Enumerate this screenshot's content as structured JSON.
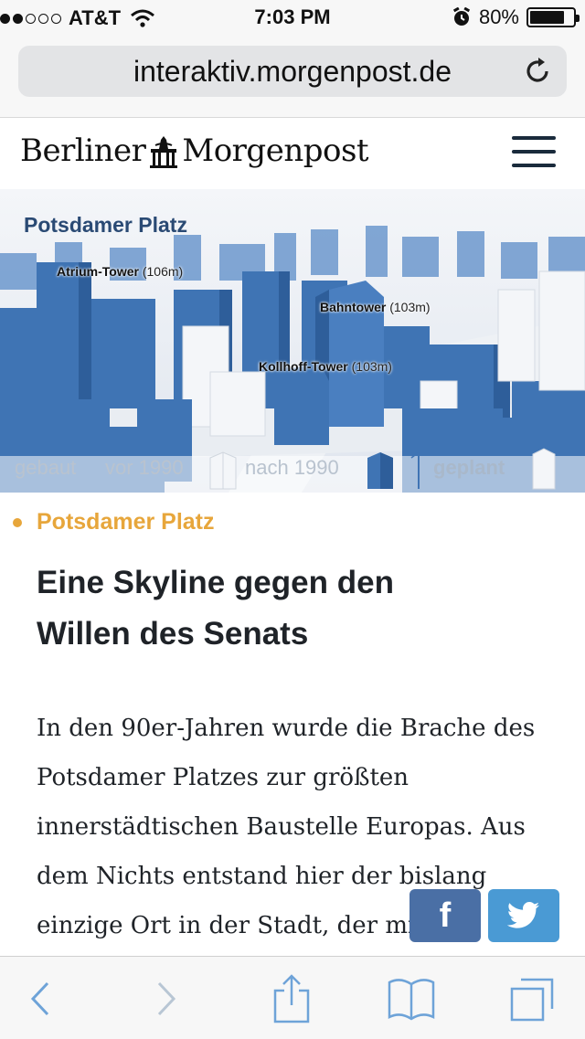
{
  "status_bar": {
    "carrier": "AT&T",
    "signal_bars_filled": 2,
    "signal_bars_total": 5,
    "time": "7:03 PM",
    "battery_percent": "80%",
    "battery_level": 0.8
  },
  "browser": {
    "url": "interaktiv.morgenpost.de",
    "reload_icon": "reload-icon",
    "toolbar_icons": [
      "back-icon",
      "forward-icon",
      "share-icon",
      "bookmarks-icon",
      "tabs-icon"
    ]
  },
  "site": {
    "logo_left": "Berliner",
    "logo_right": "Morgenpost",
    "menu_icon": "hamburger-menu-icon"
  },
  "hero": {
    "title": "Potsdamer Platz",
    "buildings": [
      {
        "name": "Atrium-Tower",
        "height": "(106m)"
      },
      {
        "name": "Bahntower",
        "height": "(103m)"
      },
      {
        "name": "Kollhoff-Tower",
        "height": "(103m)"
      }
    ],
    "legend": {
      "gebaut": "gebaut",
      "vor": "vor 1990",
      "nach": "nach 1990",
      "geplant": "geplant"
    },
    "colors": {
      "new_buildings": "#3f74b4",
      "old_buildings": "#e8ebef"
    }
  },
  "article": {
    "kicker": "Potsdamer Platz",
    "headline_line1": "Eine Skyline gegen den",
    "headline_line2": "Willen des Senats",
    "body_lines": [
      "In den 90er-Jahren wurde die Brache des",
      "Potsdamer Platzes zur größten",
      "innerstädtischen Baustelle Europas. Aus",
      "dem Nichts entstand hier der bislang",
      "einzige Ort in der Stadt, der mi"
    ],
    "accent_color": "#e7a63b"
  },
  "share": {
    "facebook_label": "f",
    "twitter_icon": "twitter-bird-icon",
    "facebook_color": "#4a6fa5",
    "twitter_color": "#4a9ad4"
  }
}
